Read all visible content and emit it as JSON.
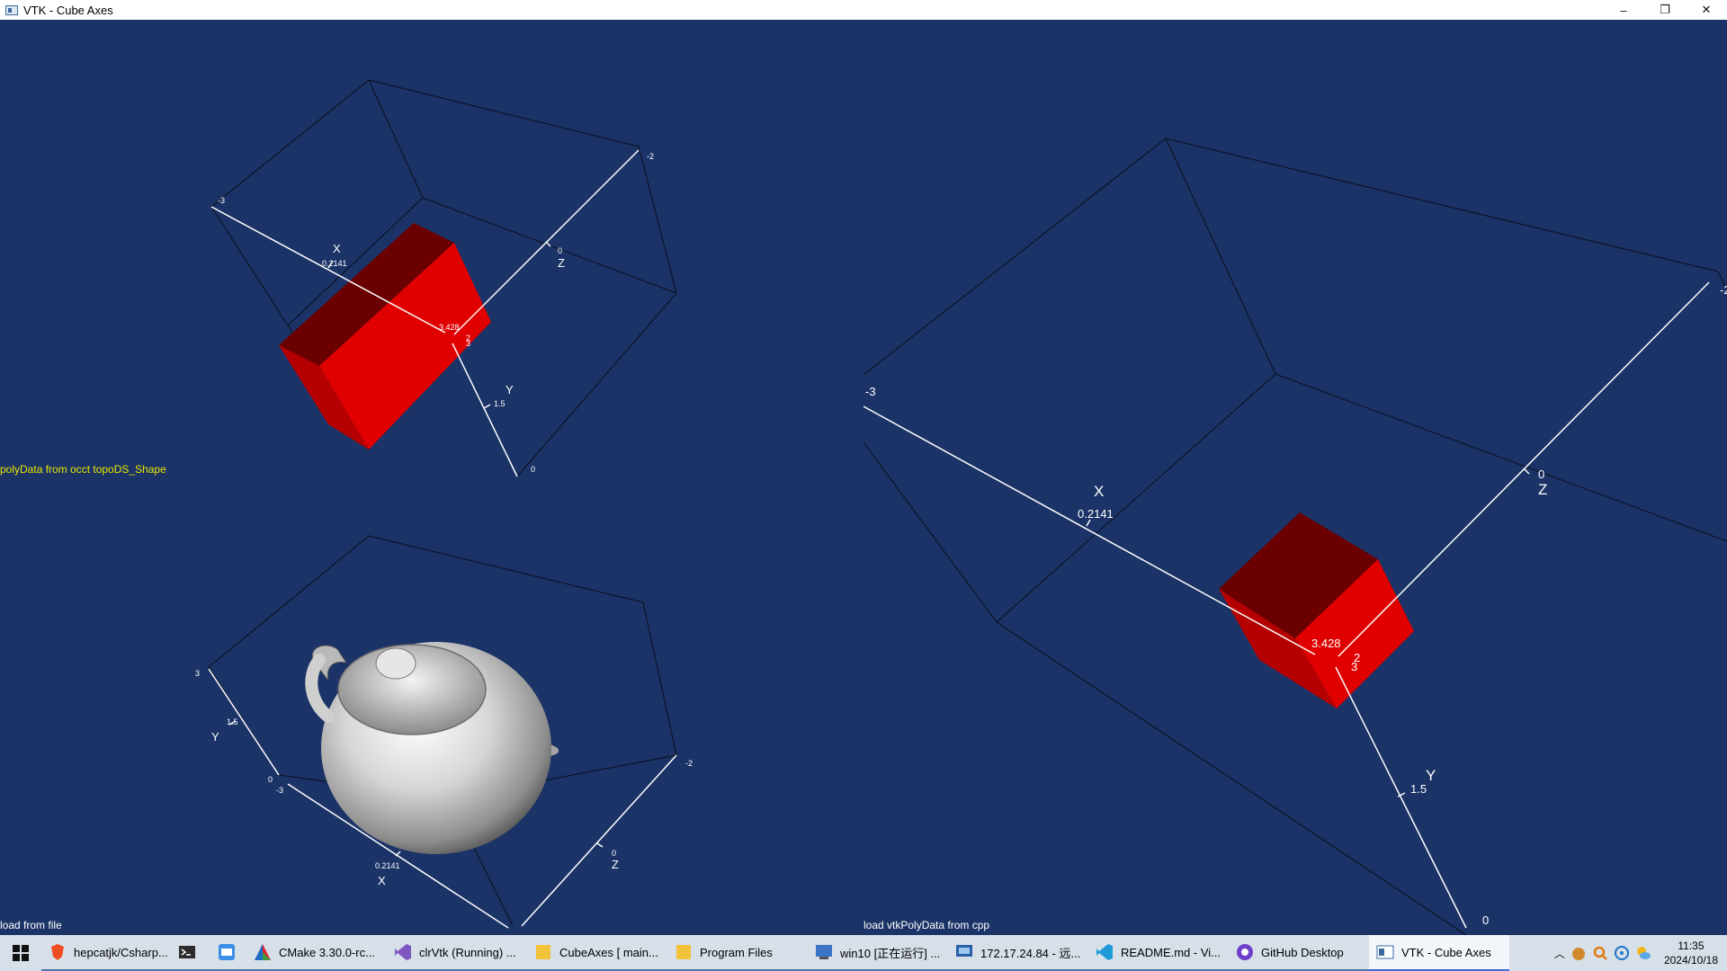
{
  "window": {
    "title": "VTK - Cube Axes",
    "minimize": "–",
    "restore": "❐",
    "close": "✕"
  },
  "viewports": {
    "top_left": {
      "label": "polyData from occt topoDS_Shape",
      "label_color": "#e6e600",
      "axes": {
        "x_title": "X",
        "y_title": "Y",
        "z_title": "Z",
        "x_mid": "0.2141",
        "x_min": "-3",
        "x_max": "3.428",
        "y_mid": "1.5",
        "y_min": "0",
        "y_max": "3",
        "z_min": "-2",
        "z_mid": "0",
        "z_max": "2"
      }
    },
    "bottom_left": {
      "label": "load from file",
      "label_color": "#ffffff",
      "axes": {
        "x_title": "X",
        "y_title": "Y",
        "z_title": "Z",
        "x_mid": "0.2141",
        "x_min": "-3",
        "y_mid": "1.5",
        "y_min": "0",
        "y_max": "3",
        "z_min": "-2",
        "z_mid": "0"
      }
    },
    "right": {
      "label": "load vtkPolyData from cpp",
      "label_color": "#ffffff",
      "axes": {
        "x_title": "X",
        "y_title": "Y",
        "z_title": "Z",
        "x_mid": "0.2141",
        "x_min": "-3",
        "x_max": "3.428",
        "y_mid": "1.5",
        "y_min": "0",
        "y_max": "3",
        "z_min": "-2",
        "z_mid": "0",
        "z_max": "2"
      }
    }
  },
  "colors": {
    "background": "#1b3367",
    "cube_front": "#e00000",
    "cube_dark": "#6b0000",
    "cube_mid": "#b40000",
    "axis_line": "#ffffff",
    "box_edge": "#0b0f1c"
  },
  "taskbar": {
    "start_icon": "windows-logo-icon",
    "items": [
      {
        "label": "hepcatjk/Csharp...",
        "icon": "brave-browser-icon"
      },
      {
        "label": "",
        "icon": "terminal-icon"
      },
      {
        "label": "",
        "icon": "notes-app-icon"
      },
      {
        "label": "CMake 3.30.0-rc...",
        "icon": "cmake-icon"
      },
      {
        "label": "clrVtk (Running) ...",
        "icon": "visual-studio-icon"
      },
      {
        "label": "CubeAxes [ main...",
        "icon": "folder-icon"
      },
      {
        "label": "Program Files",
        "icon": "folder-icon"
      },
      {
        "label": "win10 [正在运行] ...",
        "icon": "virtual-machine-icon"
      },
      {
        "label": "172.17.24.84 - 远...",
        "icon": "remote-desktop-icon"
      },
      {
        "label": "README.md - Vi...",
        "icon": "vscode-icon"
      },
      {
        "label": "GitHub Desktop",
        "icon": "github-icon"
      },
      {
        "label": "VTK - Cube Axes",
        "icon": "vtk-window-icon"
      }
    ],
    "clock_time": "11:35",
    "clock_date": "2024/10/18"
  }
}
